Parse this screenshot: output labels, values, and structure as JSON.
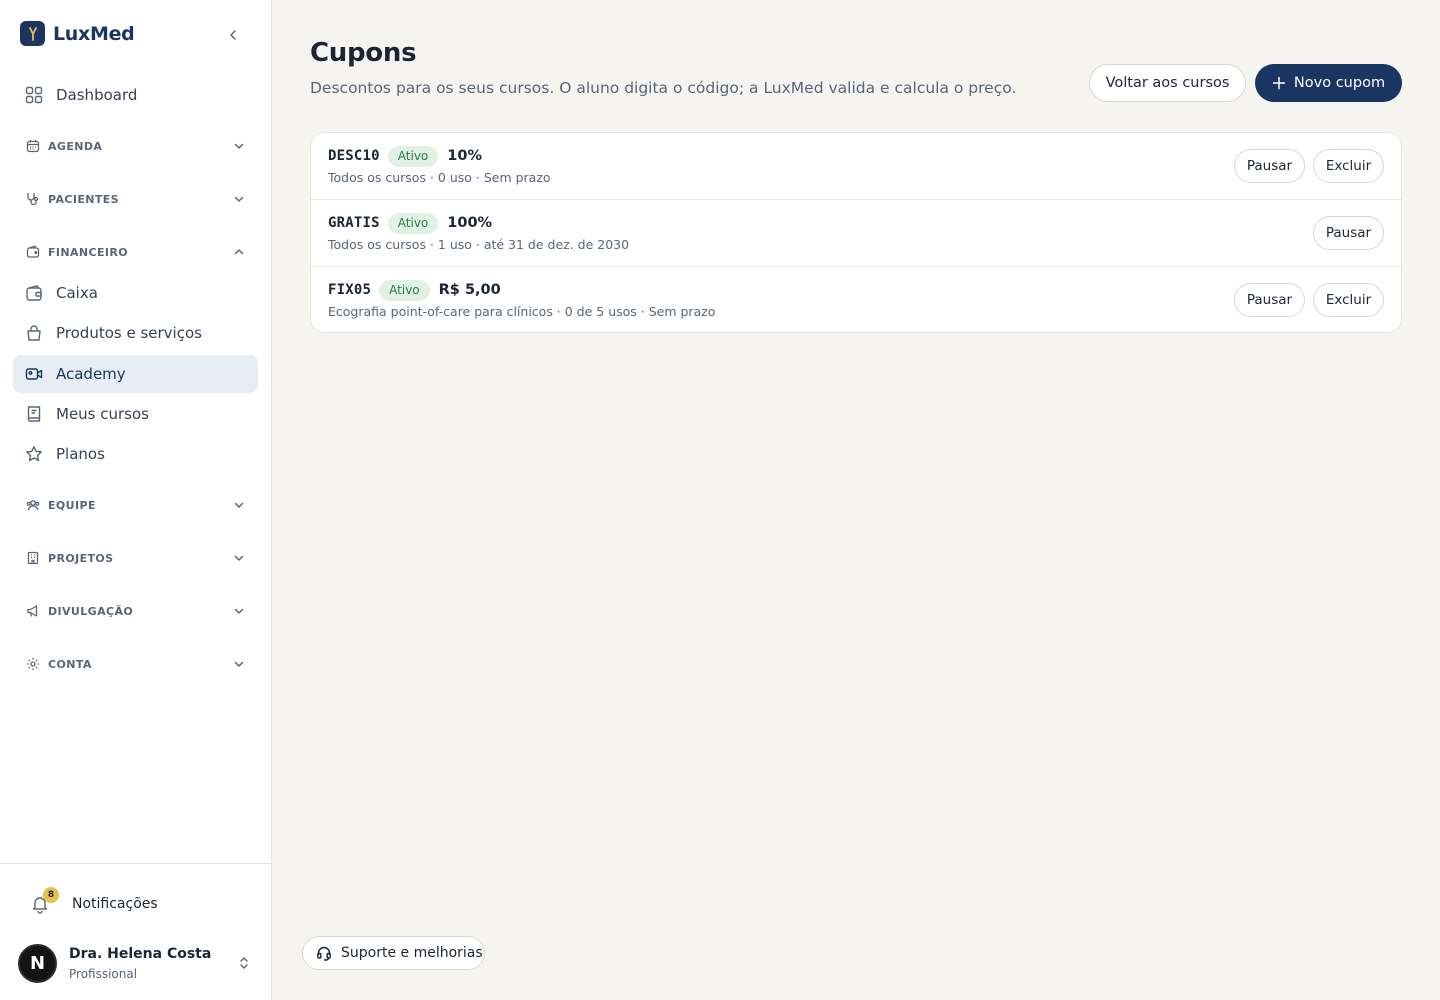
{
  "app": {
    "name": "LuxMed"
  },
  "sidebar": {
    "dashboard": "Dashboard",
    "sections": {
      "agenda": "AGENDA",
      "pacientes": "PACIENTES",
      "financeiro": "FINANCEIRO",
      "equipe": "EQUIPE",
      "projetos": "PROJETOS",
      "divulgacao": "DIVULGAÇÃO",
      "conta": "CONTA"
    },
    "financeiro_items": {
      "caixa": "Caixa",
      "produtos": "Produtos e serviços",
      "academy": "Academy",
      "meus_cursos": "Meus cursos",
      "planos": "Planos"
    },
    "active_item": "Academy",
    "notifications": {
      "label": "Notificações",
      "count": "8"
    },
    "user": {
      "initial": "N",
      "name": "Dra. Helena Costa",
      "role": "Profissional"
    }
  },
  "page": {
    "title": "Cupons",
    "subtitle": "Descontos para os seus cursos. O aluno digita o código; a LuxMed valida e calcula o preço.",
    "back_button": "Voltar aos cursos",
    "new_button": "Novo cupom"
  },
  "coupons": [
    {
      "code": "DESC10",
      "status": "Ativo",
      "value": "10%",
      "meta": "Todos os cursos · 0 uso · Sem prazo",
      "pause": "Pausar",
      "delete": "Excluir"
    },
    {
      "code": "GRATIS",
      "status": "Ativo",
      "value": "100%",
      "meta": "Todos os cursos · 1 uso · até 31 de dez. de 2030",
      "pause": "Pausar"
    },
    {
      "code": "FIX05",
      "status": "Ativo",
      "value": "R$ 5,00",
      "meta": "Ecografia point-of-care para clínicos · 0 de 5 usos · Sem prazo",
      "pause": "Pausar",
      "delete": "Excluir"
    }
  ],
  "support": {
    "label": "Suporte e melhorias"
  },
  "colors": {
    "brand": "#1a3561",
    "active_bg": "#e6edf5",
    "status_bg": "#e1f2e5",
    "status_text": "#2c7a45",
    "badge": "#e3c24a",
    "background": "#f5f4f0"
  }
}
